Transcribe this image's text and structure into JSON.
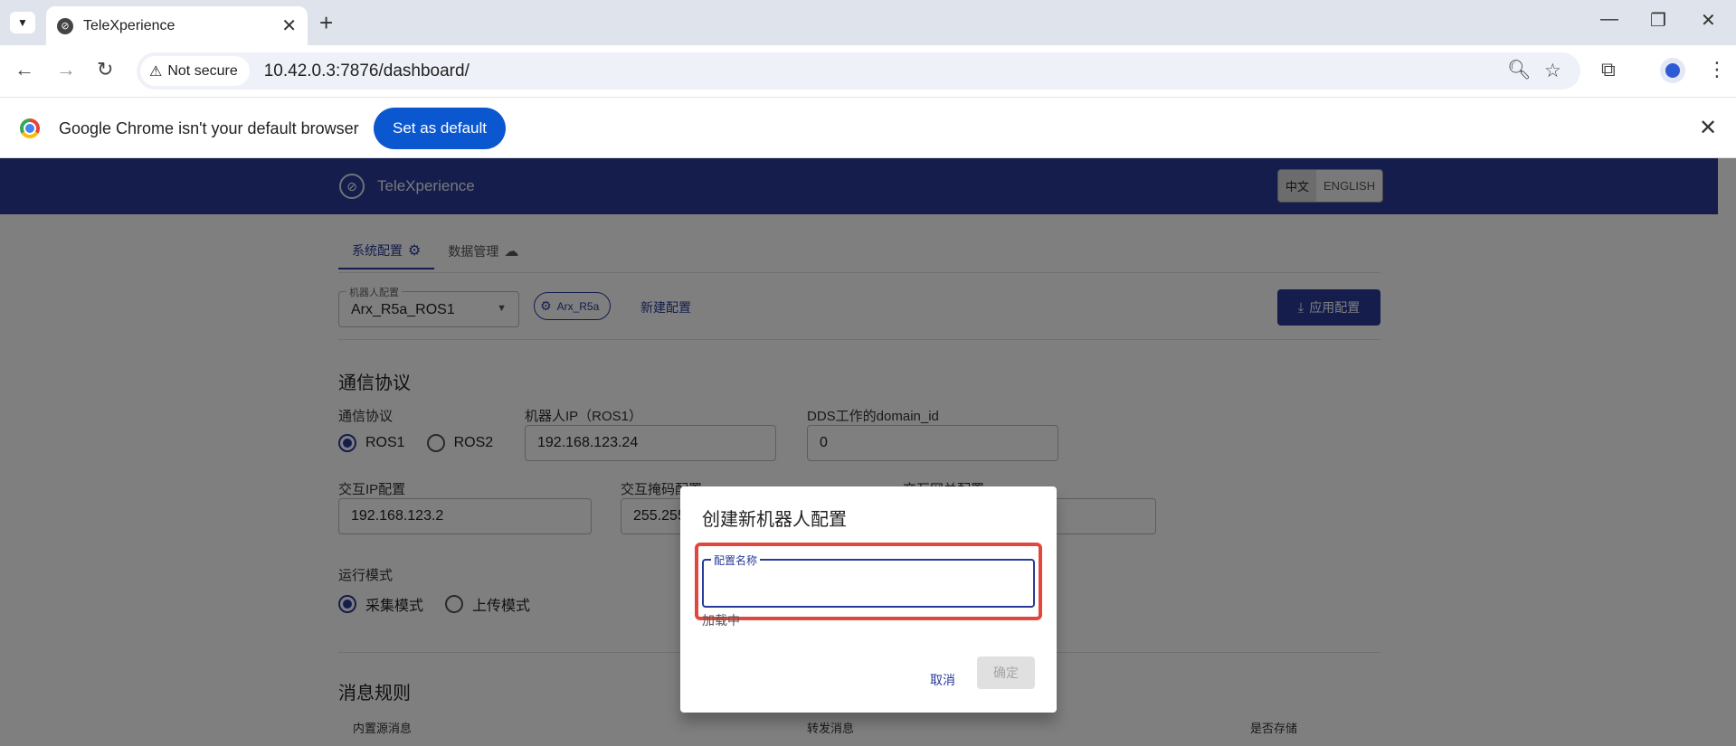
{
  "browser": {
    "tab_title": "TeleXperience",
    "security_label": "Not secure",
    "url": "10.42.0.3:7876/dashboard/",
    "infobar_text": "Google Chrome isn't your default browser",
    "set_default_label": "Set as default"
  },
  "app": {
    "name": "TeleXperience",
    "lang_zh": "中文",
    "lang_en": "ENGLISH",
    "tabs": [
      {
        "label": "系统配置",
        "icon": "gear-icon"
      },
      {
        "label": "数据管理",
        "icon": "cloud-upload-icon"
      }
    ],
    "robot_config": {
      "label": "机器人配置",
      "value": "Arx_R5a_ROS1",
      "chip": "Arx_R5a",
      "new_link": "新建配置",
      "apply_label": "应用配置"
    },
    "comm": {
      "section_title": "通信协议",
      "protocol_label": "通信协议",
      "options": [
        "ROS1",
        "ROS2"
      ],
      "selected": "ROS1",
      "robot_ip_label": "机器人IP（ROS1）",
      "robot_ip_value": "192.168.123.24",
      "domain_label": "DDS工作的domain_id",
      "domain_value": "0",
      "interact_ip_label": "交互IP配置",
      "interact_ip_value": "192.168.123.2",
      "mask_label": "交互掩码配置",
      "mask_value": "255.255",
      "gateway_label": "交互网关配置"
    },
    "mode": {
      "label": "运行模式",
      "options": [
        "采集模式",
        "上传模式"
      ],
      "selected": "采集模式"
    },
    "rules": {
      "section_title": "消息规则",
      "columns": [
        "内置源消息",
        "转发消息",
        "是否存储"
      ]
    }
  },
  "dialog": {
    "title": "创建新机器人配置",
    "field_label": "配置名称",
    "field_value": "",
    "helper_text": "加载中",
    "cancel_label": "取消",
    "confirm_label": "确定"
  },
  "colors": {
    "brand": "#283a98",
    "highlight": "#e0483f",
    "chrome_blue": "#0b57d0"
  }
}
